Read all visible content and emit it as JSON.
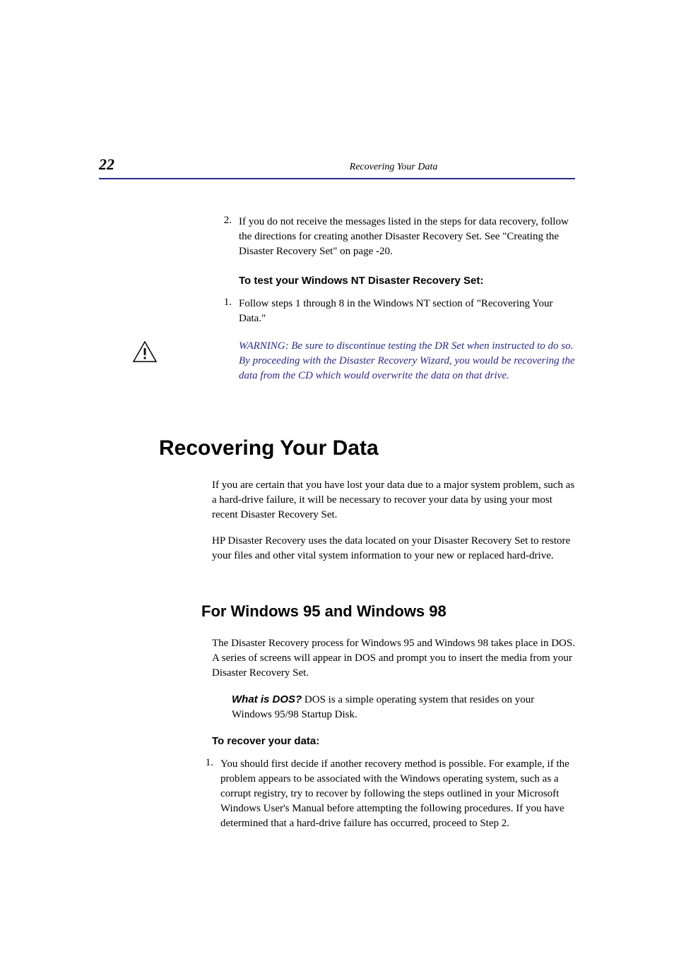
{
  "header": {
    "page_number": "22",
    "title": "Recovering Your Data"
  },
  "step2": {
    "num": "2.",
    "text": "If you do not receive the messages listed in the steps for data recovery, follow the directions for creating another Disaster Recovery Set. See \"Creating the Disaster Recovery Set\" on page -20."
  },
  "nt_heading": "To test your Windows NT Disaster Recovery Set:",
  "nt_step1": {
    "num": "1.",
    "text": "Follow steps 1 through 8 in the Windows NT section of \"Recovering Your Data.\""
  },
  "warning": "WARNING: Be sure to discontinue testing the DR Set when instructed to do so. By proceeding with the Disaster Recovery Wizard, you would be recovering the data from the CD which would overwrite the data on that drive.",
  "h1": "Recovering Your Data",
  "para1": "If you are certain that you have lost your data due to a major system problem, such as a hard-drive failure, it will be necessary to recover your data by using your most recent Disaster Recovery Set.",
  "para2": "HP Disaster Recovery uses the data located on your Disaster Recovery Set to restore your files and other vital system information to your new or replaced hard-drive.",
  "h2": "For Windows 95 and Windows 98",
  "win_para": "The Disaster Recovery process for Windows 95 and Windows 98 takes place in DOS. A series of screens will appear in DOS and prompt you to insert the media from your Disaster Recovery Set.",
  "callout": {
    "lead": "What is DOS?",
    "rest": " DOS is a simple operating system that resides on your Windows 95/98 Startup Disk."
  },
  "recover_heading": "To recover your data:",
  "recover_step1": {
    "num": "1.",
    "text": "You should first decide if another recovery method is possible. For example, if the problem appears to be associated with the Windows operating system, such as a corrupt registry, try to recover by following the steps outlined in your Microsoft Windows User's Manual before attempting the following procedures. If you have determined that a hard-drive failure has occurred, proceed to Step 2."
  }
}
